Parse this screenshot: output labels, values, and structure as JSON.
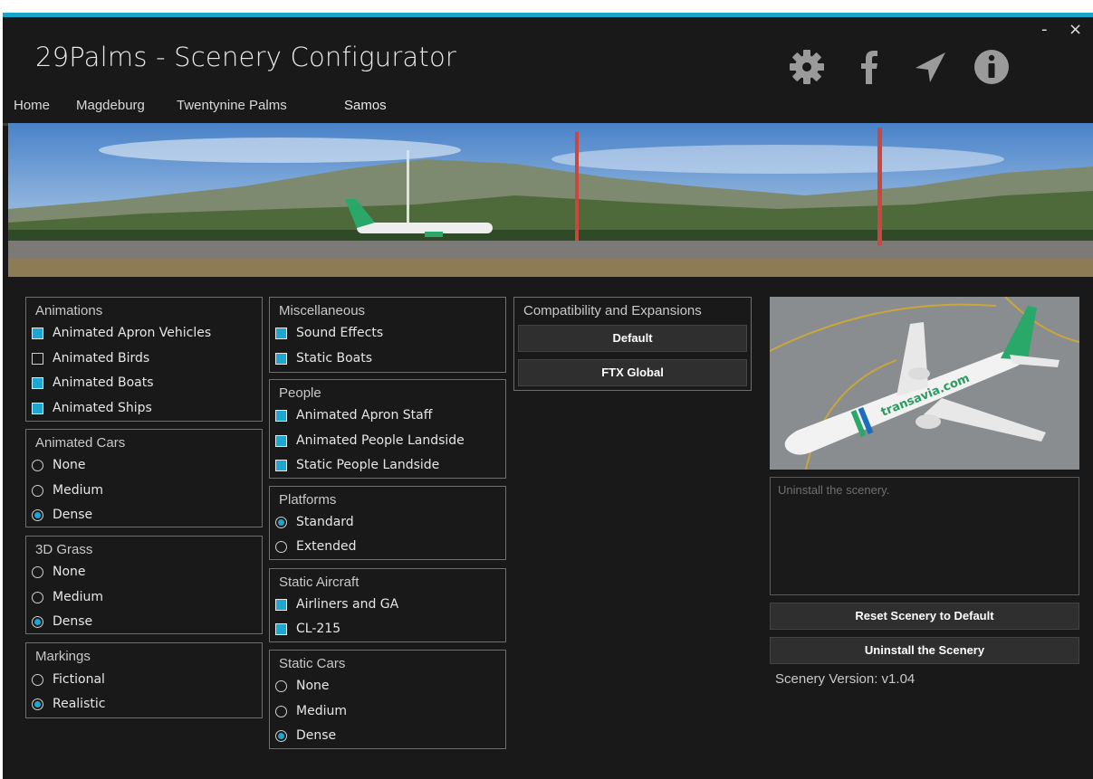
{
  "window": {
    "title": "29Palms - Scenery Configurator",
    "minimize_label": "-",
    "close_label": "×",
    "accent": "#18a4c9"
  },
  "toolbar_icons": [
    "gear-icon",
    "facebook-icon",
    "paper-plane-icon",
    "info-icon"
  ],
  "tabs": [
    {
      "label": "Home",
      "active": false
    },
    {
      "label": "Magdeburg",
      "active": false
    },
    {
      "label": "Twentynine Palms",
      "active": false
    },
    {
      "label": "Samos",
      "active": true
    }
  ],
  "groups": {
    "animations": {
      "title": "Animations",
      "options": [
        {
          "label": "Animated Apron Vehicles",
          "checked": true
        },
        {
          "label": "Animated Birds",
          "checked": false
        },
        {
          "label": "Animated Boats",
          "checked": true
        },
        {
          "label": "Animated Ships",
          "checked": true
        }
      ]
    },
    "animated_cars": {
      "title": "Animated Cars",
      "options": [
        {
          "label": "None",
          "selected": false
        },
        {
          "label": "Medium",
          "selected": false
        },
        {
          "label": "Dense",
          "selected": true
        }
      ]
    },
    "grass": {
      "title": "3D Grass",
      "options": [
        {
          "label": "None",
          "selected": false
        },
        {
          "label": "Medium",
          "selected": false
        },
        {
          "label": "Dense",
          "selected": true
        }
      ]
    },
    "markings": {
      "title": "Markings",
      "options": [
        {
          "label": "Fictional",
          "selected": false
        },
        {
          "label": "Realistic",
          "selected": true
        }
      ]
    },
    "misc": {
      "title": "Miscellaneous",
      "options": [
        {
          "label": "Sound Effects",
          "checked": true
        },
        {
          "label": "Static Boats",
          "checked": true
        }
      ]
    },
    "people": {
      "title": "People",
      "options": [
        {
          "label": "Animated Apron Staff",
          "checked": true
        },
        {
          "label": "Animated People Landside",
          "checked": true
        },
        {
          "label": "Static People Landside",
          "checked": true
        }
      ]
    },
    "platforms": {
      "title": "Platforms",
      "options": [
        {
          "label": "Standard",
          "selected": true
        },
        {
          "label": "Extended",
          "selected": false
        }
      ]
    },
    "static_aircraft": {
      "title": "Static Aircraft",
      "options": [
        {
          "label": "Airliners and GA",
          "checked": true
        },
        {
          "label": "CL-215",
          "checked": true
        }
      ]
    },
    "static_cars": {
      "title": "Static Cars",
      "options": [
        {
          "label": "None",
          "selected": false
        },
        {
          "label": "Medium",
          "selected": false
        },
        {
          "label": "Dense",
          "selected": true
        }
      ]
    },
    "compat": {
      "title": "Compatibility and Expansions",
      "buttons": [
        "Default",
        "FTX Global"
      ]
    }
  },
  "description": "Uninstall the scenery.",
  "actions": {
    "reset": "Reset Scenery to Default",
    "uninstall": "Uninstall the Scenery"
  },
  "version": "Scenery Version: v1.04",
  "preview_livery_text": "transavia.com"
}
